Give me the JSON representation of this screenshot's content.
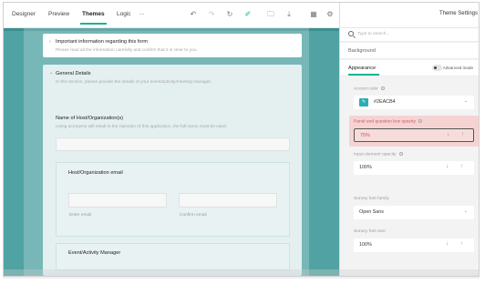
{
  "toolbar": {
    "tabs": [
      {
        "label": "Designer"
      },
      {
        "label": "Preview"
      },
      {
        "label": "Themes"
      },
      {
        "label": "Logic"
      },
      {
        "label": "···"
      }
    ],
    "icons": [
      "undo-icon",
      "redo-icon",
      "reset-icon",
      "theme-brush-icon",
      "open-icon",
      "download-icon",
      "grid-icon",
      "settings-icon"
    ]
  },
  "form": {
    "info_panel": {
      "title": "Important information regarding this form",
      "description": "Please read all the information carefully and confirm that it is clear to you."
    },
    "general_panel": {
      "title": "General Details",
      "description": "In this section, please provide the details of your event/activity/meeting manager."
    },
    "question_host": {
      "title": "Name of Host/Organization(s)",
      "description": "Using acronyms will result in the rejection of this application, the full name must be used."
    },
    "question_email": {
      "title": "Host/Organization email",
      "enter_label": "Enter email",
      "confirm_label": "Confirm email"
    },
    "question_manager": {
      "title": "Event/Activity Manager"
    }
  },
  "side": {
    "title": "Theme Settings",
    "search_placeholder": "Type to search...",
    "categories": {
      "background": "Background",
      "appearance": "Appearance",
      "advanced_mode": "Advanced mode"
    },
    "accent_color": {
      "label": "Accent color",
      "value": "#2EACB4",
      "color": "#2eacb4"
    },
    "panel_opacity": {
      "label": "Panel and question box opacity",
      "value": "75%"
    },
    "input_opacity": {
      "label": "Input element opacity",
      "value": "100%"
    },
    "font_family": {
      "label": "Survey font family",
      "value": "Open Sans"
    },
    "font_size": {
      "label": "Survey font size",
      "value": "100%"
    }
  },
  "colors": {
    "accent": "#19b394",
    "preview_background": "#51a3a3",
    "highlight": "#f5d3d3"
  }
}
